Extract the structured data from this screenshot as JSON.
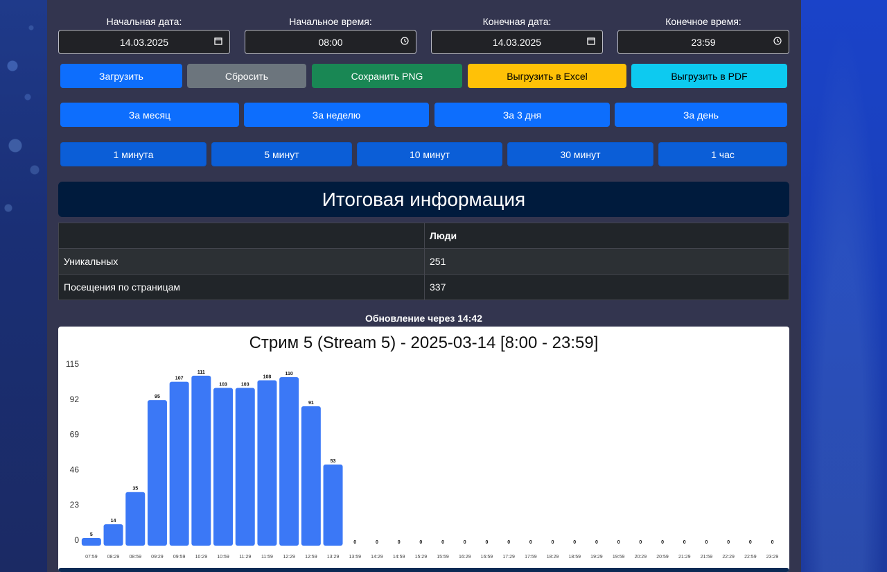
{
  "filters": {
    "start_date": {
      "label": "Начальная дата:",
      "value": "14.03.2025"
    },
    "start_time": {
      "label": "Начальное время:",
      "value": "08:00"
    },
    "end_date": {
      "label": "Конечная дата:",
      "value": "14.03.2025"
    },
    "end_time": {
      "label": "Конечное время:",
      "value": "23:59"
    }
  },
  "actions": {
    "load": "Загрузить",
    "reset": "Сбросить",
    "save_png": "Сохранить PNG",
    "export_excel": "Выгрузить в Excel",
    "export_pdf": "Выгрузить в PDF"
  },
  "periods": [
    "За месяц",
    "За неделю",
    "За 3 дня",
    "За день"
  ],
  "intervals": [
    "1 минута",
    "5 минут",
    "10 минут",
    "30 минут",
    "1 час"
  ],
  "summary": {
    "title": "Итоговая информация",
    "column_header": "Люди",
    "rows": [
      {
        "label": "Уникальных",
        "value": "251"
      },
      {
        "label": "Посещения по страницам",
        "value": "337"
      }
    ]
  },
  "update_text": "Обновление через 14:42",
  "colors": {
    "accent": "#0d6efd",
    "bar": "#3b78f6"
  },
  "chart_data": {
    "type": "bar",
    "title": "Стрим 5 (Stream 5) - 2025-03-14 [8:00 - 23:59]",
    "categories": [
      "07:59",
      "08:29",
      "08:59",
      "09:29",
      "09:59",
      "10:29",
      "10:59",
      "11:29",
      "11:59",
      "12:29",
      "12:59",
      "13:29",
      "13:59",
      "14:29",
      "14:59",
      "15:29",
      "15:59",
      "16:29",
      "16:59",
      "17:29",
      "17:59",
      "18:29",
      "18:59",
      "19:29",
      "19:59",
      "20:29",
      "20:59",
      "21:29",
      "21:59",
      "22:29",
      "22:59",
      "23:29"
    ],
    "values": [
      5,
      14,
      35,
      95,
      107,
      111,
      103,
      103,
      108,
      110,
      91,
      53,
      0,
      0,
      0,
      0,
      0,
      0,
      0,
      0,
      0,
      0,
      0,
      0,
      0,
      0,
      0,
      0,
      0,
      0,
      0,
      0
    ],
    "yticks": [
      0,
      23,
      46,
      69,
      92,
      115
    ],
    "ylim": [
      0,
      115
    ]
  }
}
